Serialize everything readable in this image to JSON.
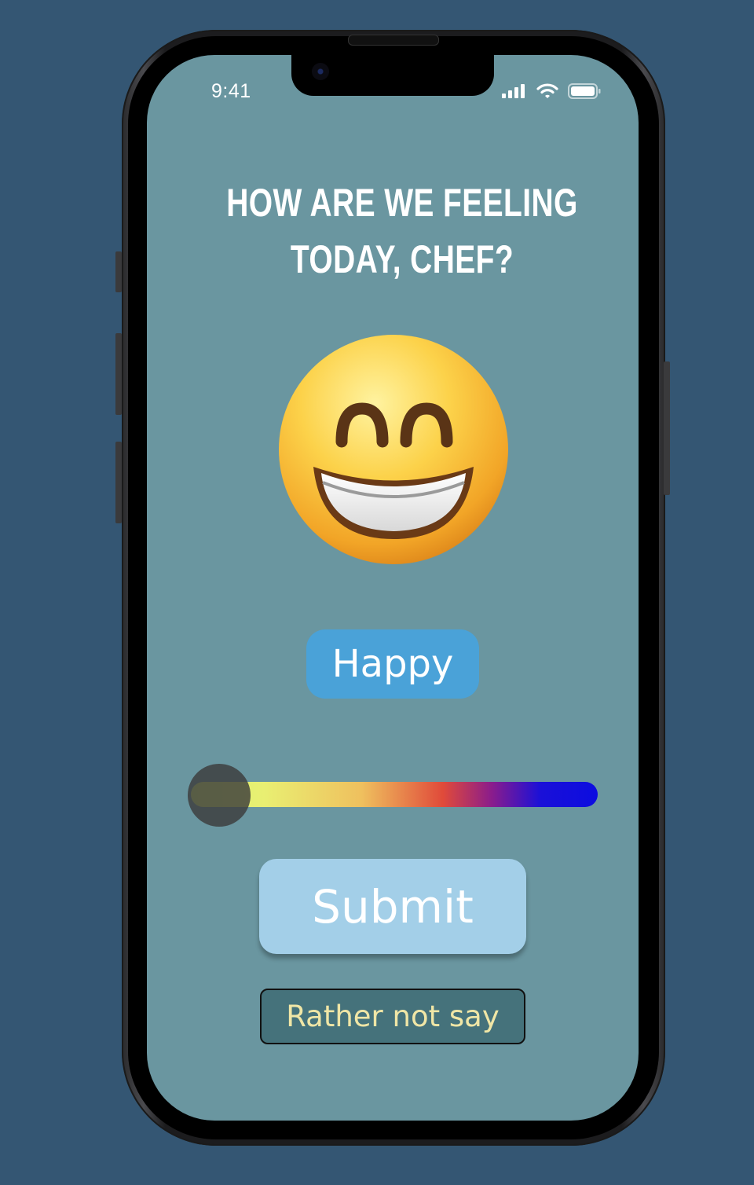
{
  "status_bar": {
    "time": "9:41",
    "icons": [
      "cellular-signal-icon",
      "wifi-icon",
      "battery-icon"
    ]
  },
  "prompt": {
    "line1": "HOW ARE WE FEELING",
    "line2": "TODAY, CHEF?"
  },
  "mood": {
    "emoji_icon": "grinning-face-with-smiling-eyes-icon",
    "label": "Happy",
    "slider_level": 0.0,
    "slider_gradient": [
      "#d8f56e",
      "#e9ef72",
      "#efc05e",
      "#e04a3a",
      "#8a1c8c",
      "#1a10d8"
    ]
  },
  "actions": {
    "submit_label": "Submit",
    "skip_label": "Rather not say"
  },
  "colors": {
    "page_background": "#345673",
    "screen_background": "#6a96a0",
    "chip": "#4aa2d8",
    "submit": "#a3cfe8",
    "skip_background": "#45727b",
    "skip_text": "#f0e6a6"
  }
}
